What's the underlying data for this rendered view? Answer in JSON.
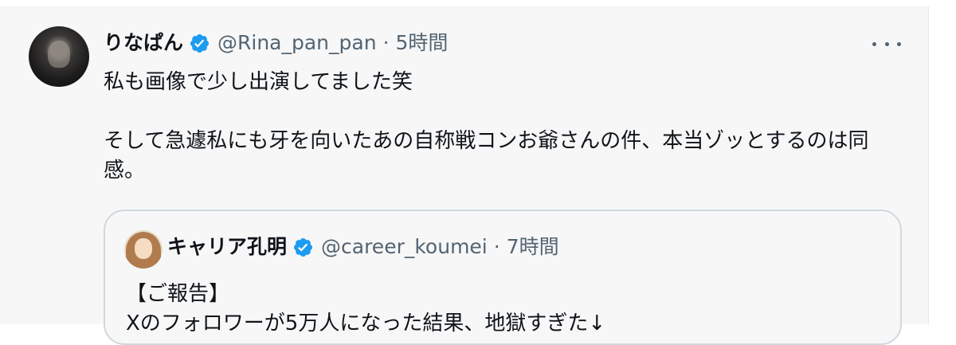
{
  "tweet": {
    "author_name": "りなぱん",
    "author_handle": "@Rina_pan_pan",
    "separator": "·",
    "time": "5時間",
    "text": "私も画像で少し出演してました笑\n\nそして急遽私にも牙を向いたあの自称戦コンお爺さんの件、本当ゾッとするのは同感。",
    "icons": {
      "verified": "verified-badge-icon",
      "more": "more-options-icon",
      "avatar": "user-avatar"
    },
    "accent_color": "#1d9bf0"
  },
  "quoted_tweet": {
    "author_name": "キャリア孔明",
    "author_handle": "@career_koumei",
    "separator": "·",
    "time": "7時間",
    "text": "【ご報告】\nXのフォロワーが5万人になった結果、地獄すぎた↓"
  }
}
